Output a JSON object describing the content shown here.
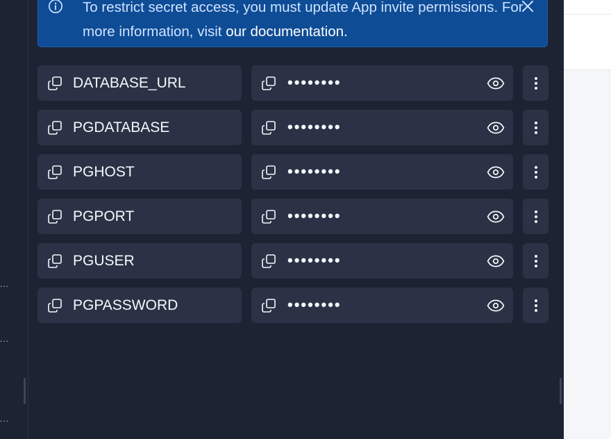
{
  "banner": {
    "text": "To restrict secret access, you must update App invite permissions. For more information, visit ",
    "link": "our documentation.",
    "info_icon": "info-icon",
    "close_icon": "close-icon"
  },
  "secrets": [
    {
      "key": "DATABASE_URL",
      "value_masked": "••••••••"
    },
    {
      "key": "PGDATABASE",
      "value_masked": "••••••••"
    },
    {
      "key": "PGHOST",
      "value_masked": "••••••••"
    },
    {
      "key": "PGPORT",
      "value_masked": "••••••••"
    },
    {
      "key": "PGUSER",
      "value_masked": "••••••••"
    },
    {
      "key": "PGPASSWORD",
      "value_masked": "••••••••"
    }
  ],
  "left_strip": {
    "truncation": "..."
  },
  "colors": {
    "background": "#1c2333",
    "card": "#2b3245",
    "banner": "#0f4c96",
    "text": "#f5f9fc"
  }
}
